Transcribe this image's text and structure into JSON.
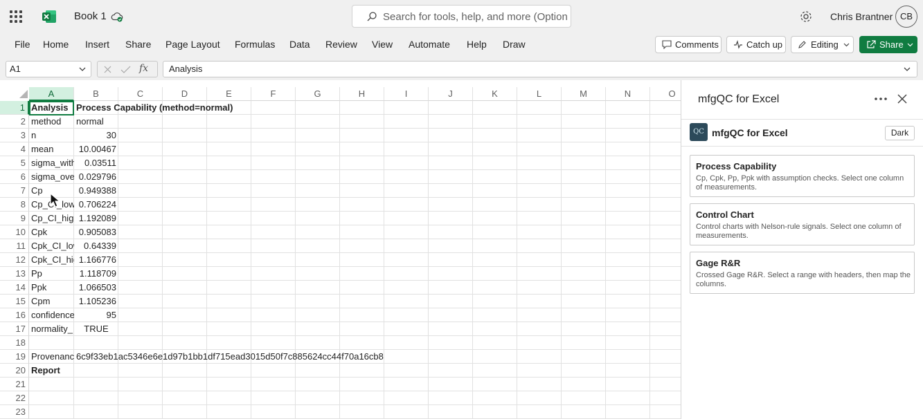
{
  "titlebar": {
    "book_title": "Book 1",
    "search_placeholder": "Search for tools, help, and more (Option + Q)",
    "user_name": "Chris Brantner",
    "user_initials": "CB"
  },
  "ribbon": {
    "tabs": [
      "File",
      "Home",
      "Insert",
      "Share",
      "Page Layout",
      "Formulas",
      "Data",
      "Review",
      "View",
      "Automate",
      "Help",
      "Draw"
    ],
    "comments_label": "Comments",
    "catchup_label": "Catch up",
    "editing_label": "Editing",
    "share_label": "Share"
  },
  "formula_bar": {
    "name_box": "A1",
    "fx_label": "fx",
    "formula": "Analysis"
  },
  "grid": {
    "columns": [
      "A",
      "B",
      "C",
      "D",
      "E",
      "F",
      "G",
      "H",
      "I",
      "J",
      "K",
      "L",
      "M",
      "N",
      "O"
    ],
    "rows": [
      "1",
      "2",
      "3",
      "4",
      "5",
      "6",
      "7",
      "8",
      "9",
      "10",
      "11",
      "12",
      "13",
      "14",
      "15",
      "16",
      "17",
      "18",
      "19",
      "20",
      "21",
      "22",
      "23"
    ],
    "selected_cell": "A1",
    "cells": [
      {
        "r": 1,
        "c": "A",
        "v": "Analysis",
        "bold": true
      },
      {
        "r": 1,
        "c": "B",
        "v": "Process Capability (method=normal)",
        "bold": true,
        "over": true
      },
      {
        "r": 2,
        "c": "A",
        "v": "method"
      },
      {
        "r": 2,
        "c": "B",
        "v": "normal"
      },
      {
        "r": 3,
        "c": "A",
        "v": "n"
      },
      {
        "r": 3,
        "c": "B",
        "v": "30",
        "num": true
      },
      {
        "r": 4,
        "c": "A",
        "v": "mean"
      },
      {
        "r": 4,
        "c": "B",
        "v": "10.00467",
        "num": true
      },
      {
        "r": 5,
        "c": "A",
        "v": "sigma_within"
      },
      {
        "r": 5,
        "c": "B",
        "v": "0.03511",
        "num": true
      },
      {
        "r": 6,
        "c": "A",
        "v": "sigma_overall"
      },
      {
        "r": 6,
        "c": "B",
        "v": "0.029796",
        "num": true
      },
      {
        "r": 7,
        "c": "A",
        "v": "Cp"
      },
      {
        "r": 7,
        "c": "B",
        "v": "0.949388",
        "num": true
      },
      {
        "r": 8,
        "c": "A",
        "v": "Cp_CI_low"
      },
      {
        "r": 8,
        "c": "B",
        "v": "0.706224",
        "num": true
      },
      {
        "r": 9,
        "c": "A",
        "v": "Cp_CI_high"
      },
      {
        "r": 9,
        "c": "B",
        "v": "1.192089",
        "num": true
      },
      {
        "r": 10,
        "c": "A",
        "v": "Cpk"
      },
      {
        "r": 10,
        "c": "B",
        "v": "0.905083",
        "num": true
      },
      {
        "r": 11,
        "c": "A",
        "v": "Cpk_CI_low"
      },
      {
        "r": 11,
        "c": "B",
        "v": "0.64339",
        "num": true
      },
      {
        "r": 12,
        "c": "A",
        "v": "Cpk_CI_high"
      },
      {
        "r": 12,
        "c": "B",
        "v": "1.166776",
        "num": true
      },
      {
        "r": 13,
        "c": "A",
        "v": "Pp"
      },
      {
        "r": 13,
        "c": "B",
        "v": "1.118709",
        "num": true
      },
      {
        "r": 14,
        "c": "A",
        "v": "Ppk"
      },
      {
        "r": 14,
        "c": "B",
        "v": "1.066503",
        "num": true
      },
      {
        "r": 15,
        "c": "A",
        "v": "Cpm"
      },
      {
        "r": 15,
        "c": "B",
        "v": "1.105236",
        "num": true
      },
      {
        "r": 16,
        "c": "A",
        "v": "confidence"
      },
      {
        "r": 16,
        "c": "B",
        "v": "95",
        "num": true
      },
      {
        "r": 17,
        "c": "A",
        "v": "normality_"
      },
      {
        "r": 17,
        "c": "B",
        "v": "TRUE",
        "ctr": true
      },
      {
        "r": 19,
        "c": "A",
        "v": "Provenance"
      },
      {
        "r": 19,
        "c": "B",
        "v": "6c9f33eb1ac5346e6e1d97b1bb1df715ead3015d50f7c885624cc44f70a16cb8",
        "over": true
      },
      {
        "r": 20,
        "c": "A",
        "v": "Report",
        "bold": true
      }
    ]
  },
  "panel": {
    "title": "mfgQC for Excel",
    "logo_text": "QC",
    "addin_name": "mfgQC for Excel",
    "theme_button": "Dark",
    "cards": [
      {
        "title": "Process Capability",
        "desc": "Cp, Cpk, Pp, Ppk with assumption checks. Select one column of measurements."
      },
      {
        "title": "Control Chart",
        "desc": "Control charts with Nelson-rule signals. Select one column of measurements."
      },
      {
        "title": "Gage R&R",
        "desc": "Crossed Gage R&R. Select a range with headers, then map the columns."
      }
    ]
  },
  "colors": {
    "accent_green": "#107c41",
    "selection_fill": "#d3f0e0"
  }
}
